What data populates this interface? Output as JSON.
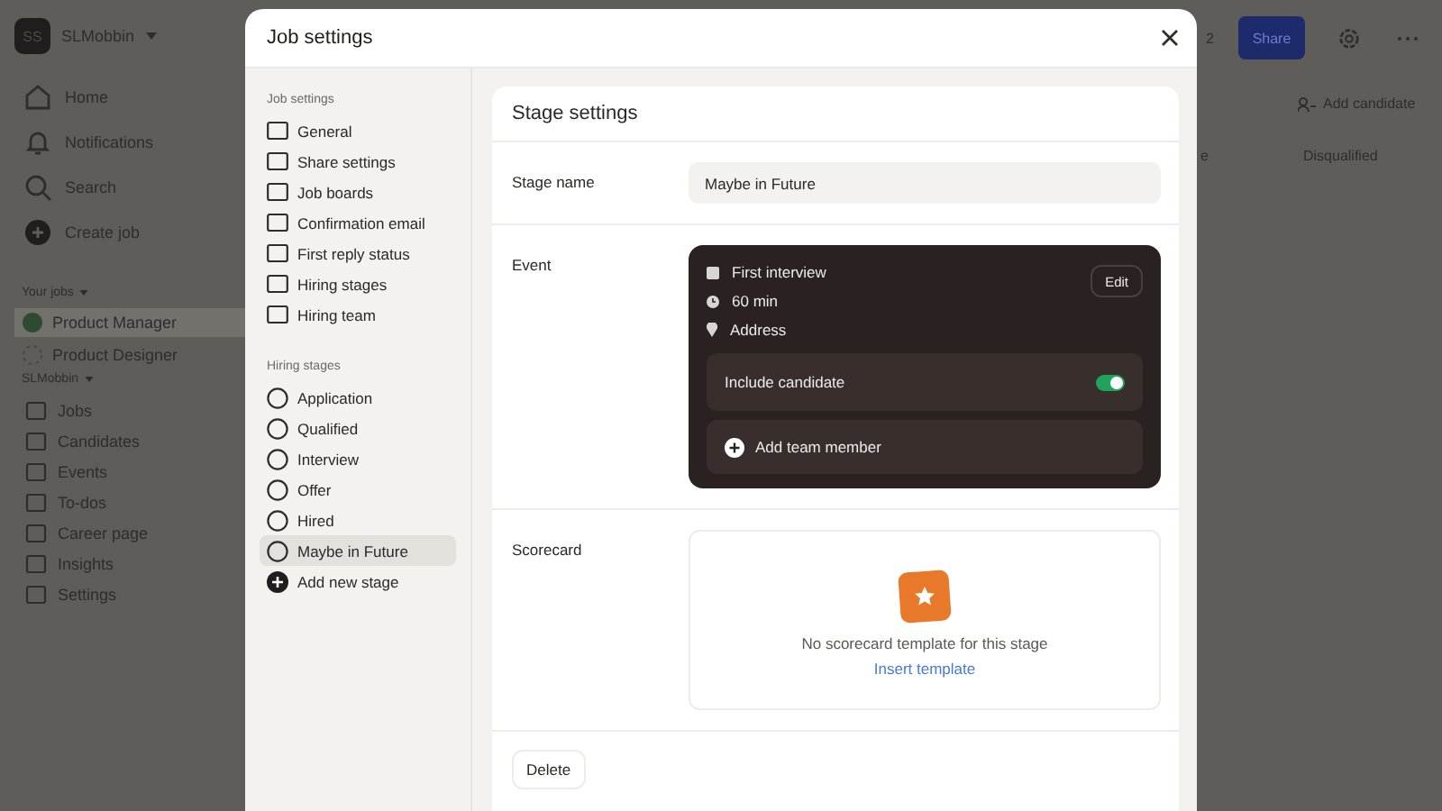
{
  "background": {
    "workspace": {
      "avatar": "SS",
      "name": "SLMobbin"
    },
    "nav": [
      "Home",
      "Notifications",
      "Search",
      "Create job"
    ],
    "jobs_heading": "Your jobs",
    "jobs": [
      {
        "label": "Product Manager",
        "selected": true
      },
      {
        "label": "Product Designer",
        "selected": false
      }
    ],
    "org_heading": "SLMobbin",
    "org_items": [
      "Jobs",
      "Candidates",
      "Events",
      "To-dos",
      "Career page",
      "Insights",
      "Settings"
    ],
    "count": "2",
    "share_button": "Share",
    "add_candidate": "Add candidate",
    "columns": [
      "e",
      "Disqualified"
    ]
  },
  "modal": {
    "title": "Job settings",
    "sidebar": {
      "job_heading": "Job settings",
      "job_items": [
        "General",
        "Share settings",
        "Job boards",
        "Confirmation email",
        "First reply status",
        "Hiring stages",
        "Hiring team"
      ],
      "stages_heading": "Hiring stages",
      "stages": [
        {
          "label": "Application",
          "selected": false
        },
        {
          "label": "Qualified",
          "selected": false
        },
        {
          "label": "Interview",
          "selected": false
        },
        {
          "label": "Offer",
          "selected": false
        },
        {
          "label": "Hired",
          "selected": false
        },
        {
          "label": "Maybe in Future",
          "selected": true
        }
      ],
      "add_stage": "Add new stage"
    },
    "panel": {
      "title": "Stage settings",
      "stage_name_label": "Stage name",
      "stage_name": "Maybe in Future",
      "event_label": "Event",
      "event": {
        "details": [
          "First interview",
          "60 min",
          "Address"
        ],
        "edit": "Edit",
        "include_candidate": {
          "label": "Include candidate",
          "on": true
        },
        "add_member": "Add team member"
      },
      "scorecard_label": "Scorecard",
      "scorecard": {
        "message": "No scorecard template for this stage",
        "link": "Insert template"
      },
      "delete": "Delete"
    }
  }
}
